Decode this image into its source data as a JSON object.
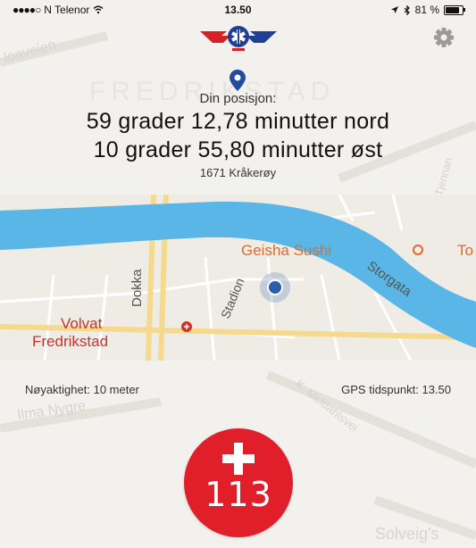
{
  "status_bar": {
    "carrier": "N Telenor",
    "time": "13.50",
    "battery": "81 %",
    "battery_level": 0.81
  },
  "header": {
    "logo_icon": "emergency-star-of-life-logo",
    "settings_icon": "gear-icon"
  },
  "position": {
    "label": "Din posisjon:",
    "latitude": "59 grader 12,78 minutter nord",
    "longitude": "10 grader 55,80 minutter øst",
    "place": "1671 Kråkerøy"
  },
  "map": {
    "labels": {
      "geisha": "Geisha Sushi",
      "to": "To",
      "dokka": "Dokka",
      "stadion": "Stadion",
      "storgata": "Storgata",
      "volvat1": "Volvat",
      "volvat2": "Fredrikstad"
    },
    "background_labels": {
      "loaveien": "loaveien",
      "ilma": "Ilma Nygre",
      "meldahls": "K. Meldahlsvei",
      "solveig": "Solveig's",
      "tjennan": "Tjennan",
      "fredrikstad": "FREDRIKSTAD"
    },
    "colors": {
      "water": "#5ab6e6",
      "poi": "#e26a2c",
      "hospital": "#d0312d",
      "location": "#2a5ea8"
    }
  },
  "info": {
    "accuracy": "Nøyaktighet: 10 meter",
    "gps_time": "GPS tidspunkt: 13.50"
  },
  "emergency": {
    "number": "113",
    "color": "#e11f2a"
  }
}
